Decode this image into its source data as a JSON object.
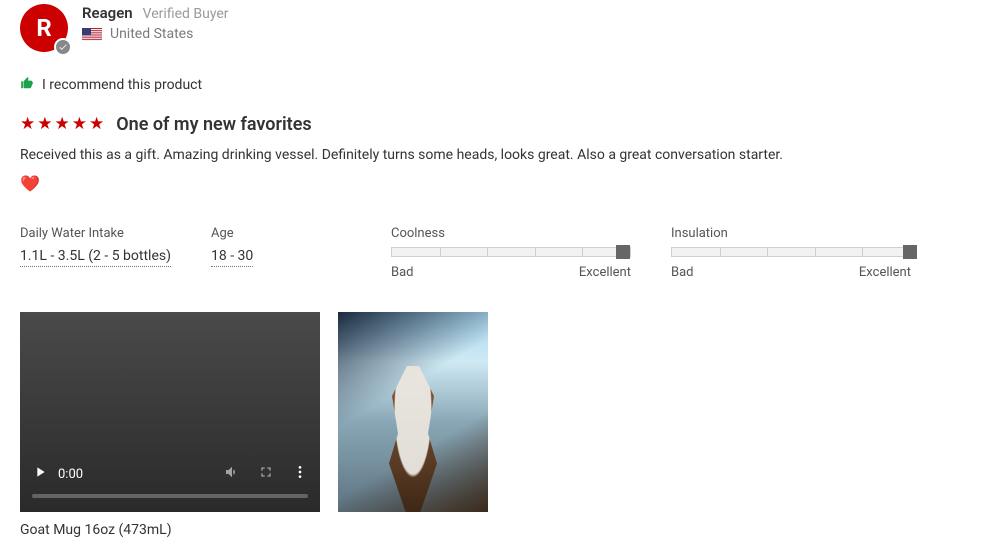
{
  "reviewer": {
    "initial": "R",
    "name": "Reagen",
    "verified_label": "Verified Buyer",
    "country": "United States"
  },
  "recommend_text": "I recommend this product",
  "stars_count": 5,
  "title": "One of my new favorites",
  "body": "Received this as a gift. Amazing drinking vessel. Definitely turns some heads, looks great. Also a great conversation starter.",
  "attributes": {
    "daily_water_intake": {
      "label": "Daily Water Intake",
      "value": "1.1L - 3.5L (2 - 5 bottles)"
    },
    "age": {
      "label": "Age",
      "value": "18 - 30"
    }
  },
  "sliders": {
    "coolness": {
      "label": "Coolness",
      "low": "Bad",
      "high": "Excellent",
      "pct": 97
    },
    "insulation": {
      "label": "Insulation",
      "low": "Bad",
      "high": "Excellent",
      "pct": 100
    }
  },
  "video": {
    "time": "0:00"
  },
  "product_caption": "Goat Mug 16oz (473mL)"
}
